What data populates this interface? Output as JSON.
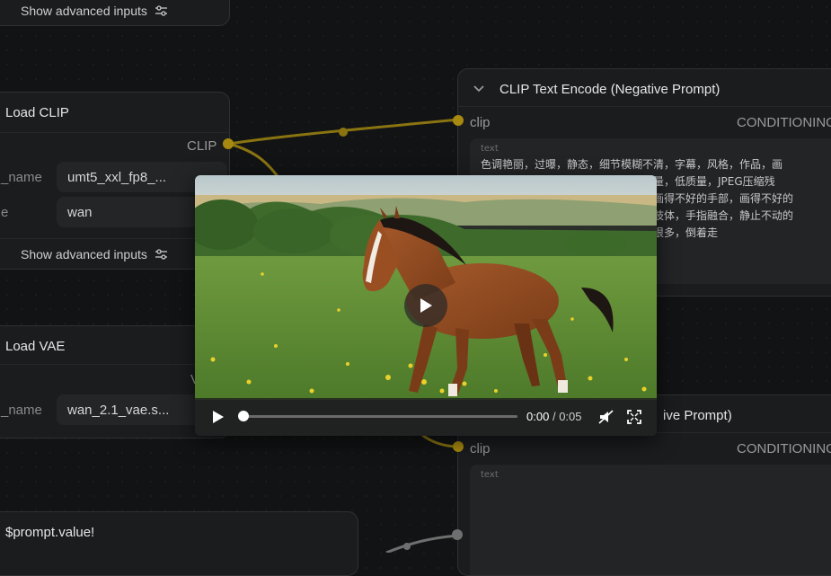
{
  "node_top": {
    "advanced_label": "Show advanced inputs"
  },
  "node_load_clip": {
    "title": "Load CLIP",
    "output_port": "CLIP",
    "rows": [
      {
        "label": "_name",
        "value": "umt5_xxl_fp8_..."
      },
      {
        "label": "e",
        "value": "wan"
      }
    ],
    "advanced_label": "Show advanced inputs"
  },
  "node_load_vae": {
    "title": "Load VAE",
    "output_port": "V",
    "rows": [
      {
        "label": "_name",
        "value": "wan_2.1_vae.s..."
      }
    ]
  },
  "node_prompt": {
    "title": "$prompt.value!"
  },
  "node_clip_negative": {
    "title": "CLIP Text Encode (Negative Prompt)",
    "input_port": "clip",
    "output_port": "CONDITIONING",
    "text_label": "text",
    "text_lines": [
      "色调艳丽，过曝，静态，细节模糊不清，字幕，风格，作品，画",
      "作，画面，静止，整体发灰，最差质量，低质量，JPEG压缩残",
      "留，丑陋的，残缺的，多余的手指，画得不好的手部，画得不好的",
      "脸部，畸形的，毁容的，形态畸形的肢体，手指融合，静止不动的",
      "画面，杂乱的背景，三条腿，背景人很多，倒着走"
    ]
  },
  "node_clip_positive": {
    "title_fragment": "ive Prompt)",
    "input_port": "clip",
    "output_port": "CONDITIONING",
    "text_label": "text"
  },
  "video_player": {
    "current_time": "0:00",
    "separator": "/",
    "duration": "0:05",
    "progress": 0.0
  },
  "colors": {
    "clip_wire": "#8a7411",
    "vae_wire": "#6f6f6f",
    "accent_port": "#a8890f"
  },
  "icons": [
    "chevron-down-icon",
    "sliders-icon",
    "play-icon",
    "mute-icon",
    "fullscreen-icon"
  ]
}
